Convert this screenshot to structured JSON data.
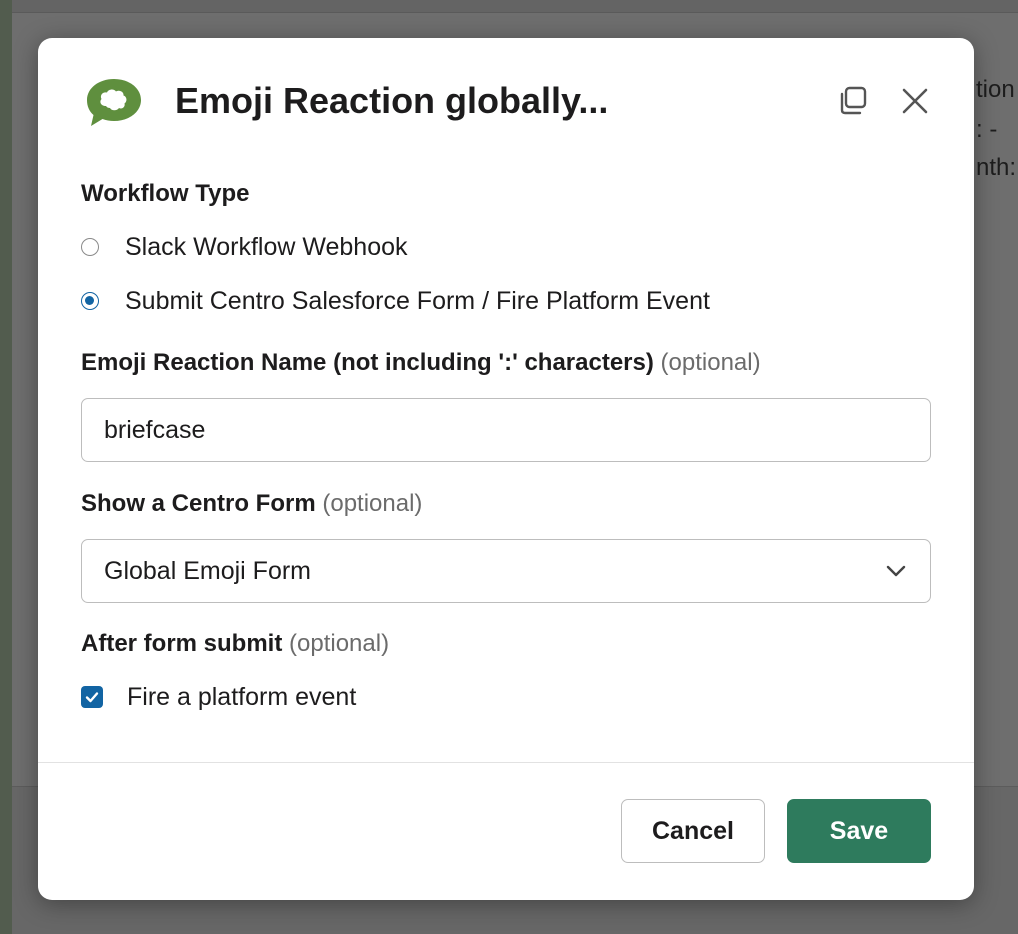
{
  "background": {
    "fragments": [
      "tion",
      ": -",
      "nth:"
    ]
  },
  "modal": {
    "title": "Emoji Reaction globally...",
    "icons": {
      "app": "centro-chat-bubble-icon",
      "copy": "copy-icon",
      "close": "close-icon"
    },
    "workflow_type": {
      "label": "Workflow Type",
      "options": [
        {
          "label": "Slack Workflow Webhook",
          "selected": false
        },
        {
          "label": "Submit Centro Salesforce Form / Fire Platform Event",
          "selected": true
        }
      ]
    },
    "emoji_name": {
      "label": "Emoji Reaction Name (not including ':' characters)",
      "optional": "(optional)",
      "value": "briefcase"
    },
    "centro_form": {
      "label": "Show a Centro Form",
      "optional": "(optional)",
      "selected": "Global Emoji Form"
    },
    "after_submit": {
      "label": "After form submit",
      "optional": "(optional)",
      "checkbox_label": "Fire a platform event",
      "checked": true
    },
    "footer": {
      "cancel_label": "Cancel",
      "save_label": "Save"
    }
  },
  "colors": {
    "accent": "#1264a3",
    "save_button": "#2e7b5d",
    "brand_icon": "#5f8f3e"
  }
}
